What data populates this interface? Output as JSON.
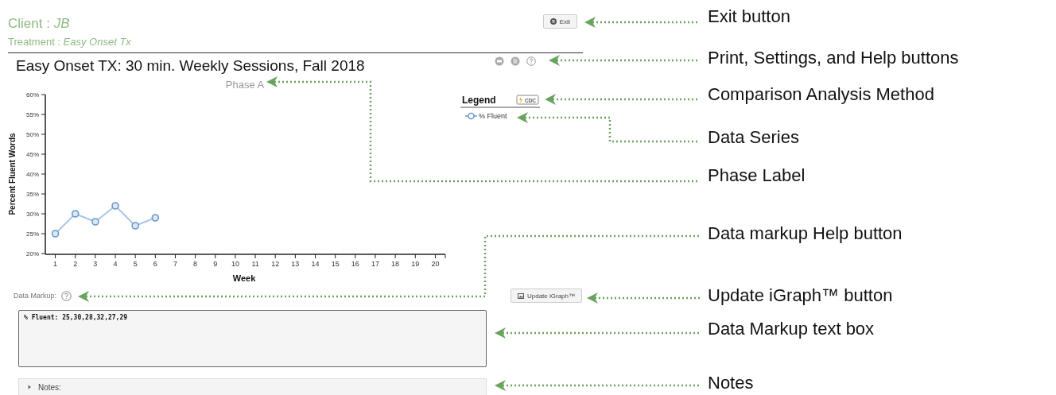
{
  "header": {
    "client_label": "Client : ",
    "client": "JB",
    "treatment_label": "Treatment : ",
    "treatment": "Easy Onset Tx"
  },
  "exit_button": "Exit",
  "graph": {
    "title": "Easy Onset TX: 30 min. Weekly Sessions, Fall 2018",
    "phase_label": "Phase A",
    "legend": {
      "title": "Legend",
      "method_badge": "CDC"
    },
    "chart_data": {
      "type": "line",
      "xlabel": "Week",
      "ylabel": "Percent Fluent Words",
      "x": [
        1,
        2,
        3,
        4,
        5,
        6
      ],
      "xlim": [
        0.5,
        20.5
      ],
      "ylim": [
        20,
        60
      ],
      "xticks": [
        1,
        2,
        3,
        4,
        5,
        6,
        7,
        8,
        9,
        10,
        11,
        12,
        13,
        14,
        15,
        16,
        17,
        18,
        19,
        20
      ],
      "yticks": [
        {
          "value": 20,
          "label": "20%"
        },
        {
          "value": 25,
          "label": "25%"
        },
        {
          "value": 30,
          "label": "30%"
        },
        {
          "value": 35,
          "label": "35%"
        },
        {
          "value": 40,
          "label": "40%"
        },
        {
          "value": 45,
          "label": "45%"
        },
        {
          "value": 50,
          "label": "50%"
        },
        {
          "value": 55,
          "label": "55%"
        },
        {
          "value": 60,
          "label": "60%"
        }
      ],
      "series": [
        {
          "name": "% Fluent",
          "color": "#6699cc",
          "marker": "circle",
          "values": [
            25,
            30,
            28,
            32,
            27,
            29
          ]
        }
      ]
    }
  },
  "data_markup": {
    "label": "Data Markup:",
    "update_button": "Update iGraph™",
    "value": "% Fluent: 25,30,28,32,27,29"
  },
  "notes": {
    "label": "Notes:",
    "expanded": false
  },
  "annotations": [
    {
      "label": "Exit button"
    },
    {
      "label": "Print, Settings, and Help buttons"
    },
    {
      "label": "Comparison Analysis Method"
    },
    {
      "label": "Data Series"
    },
    {
      "label": "Phase Label"
    },
    {
      "label": "Data markup Help button"
    },
    {
      "label": "Update iGraph™ button"
    },
    {
      "label": "Data Markup text box"
    },
    {
      "label": "Notes"
    }
  ]
}
